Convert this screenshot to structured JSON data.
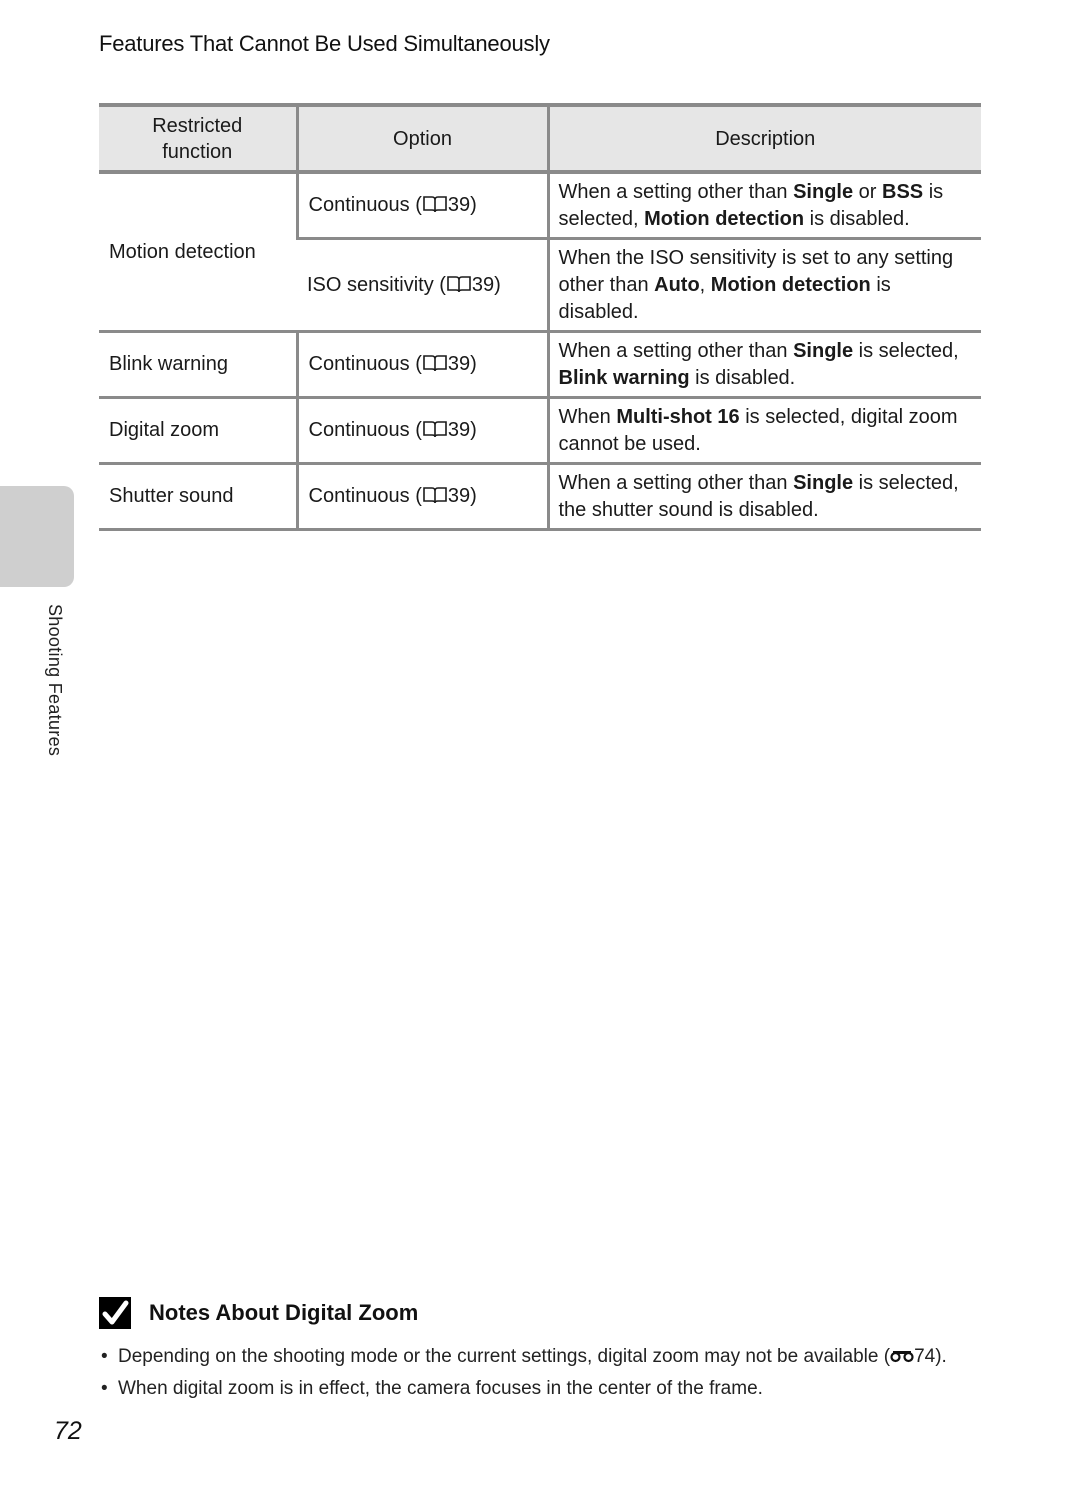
{
  "section_title": "Features That Cannot Be Used Simultaneously",
  "table": {
    "headers": [
      "Restricted function",
      "Option",
      "Description"
    ],
    "header_first_lines": [
      "Restricted",
      "function"
    ],
    "rows": [
      {
        "function": "Motion detection",
        "options": [
          {
            "option": "Continuous (",
            "ref": "39)",
            "description": [
              {
                "t": "When a setting other than ",
                "b": false
              },
              {
                "t": "Single",
                "b": true
              },
              {
                "t": " or ",
                "b": false
              },
              {
                "t": "BSS",
                "b": true
              },
              {
                "t": " is selected, ",
                "b": false
              },
              {
                "t": "Motion detection",
                "b": true
              },
              {
                "t": " is disabled.",
                "b": false
              }
            ]
          },
          {
            "option": "ISO sensitivity (",
            "ref": "39)",
            "description": [
              {
                "t": "When the ISO sensitivity is set to any setting other than ",
                "b": false
              },
              {
                "t": "Auto",
                "b": true
              },
              {
                "t": ", ",
                "b": false
              },
              {
                "t": "Motion detection",
                "b": true
              },
              {
                "t": " is disabled.",
                "b": false
              }
            ]
          }
        ]
      },
      {
        "function": "Blink warning",
        "options": [
          {
            "option": "Continuous (",
            "ref": "39)",
            "description": [
              {
                "t": "When a setting other than ",
                "b": false
              },
              {
                "t": "Single",
                "b": true
              },
              {
                "t": " is selected, ",
                "b": false
              },
              {
                "t": "Blink warning",
                "b": true
              },
              {
                "t": " is disabled.",
                "b": false
              }
            ]
          }
        ]
      },
      {
        "function": "Digital zoom",
        "options": [
          {
            "option": "Continuous (",
            "ref": "39)",
            "description": [
              {
                "t": "When ",
                "b": false
              },
              {
                "t": "Multi-shot 16",
                "b": true
              },
              {
                "t": " is selected, digital zoom cannot be used.",
                "b": false
              }
            ]
          }
        ]
      },
      {
        "function": "Shutter sound",
        "options": [
          {
            "option": "Continuous (",
            "ref": "39)",
            "description": [
              {
                "t": "When a setting other than ",
                "b": false
              },
              {
                "t": "Single",
                "b": true
              },
              {
                "t": " is selected, the shutter sound is disabled.",
                "b": false
              }
            ]
          }
        ]
      }
    ]
  },
  "side_tab": {
    "label": "Shooting Features",
    "color": "#cfcfcf"
  },
  "notes": {
    "icon": "checkbox-check-icon",
    "title": "Notes About Digital Zoom",
    "items": [
      {
        "before": "Depending on the shooting mode or the current settings, digital zoom may not be available (",
        "icon": "binoculars-reference-icon",
        "after": "74)."
      },
      {
        "before": "When digital zoom is in effect, the camera focuses in the center of the frame.",
        "icon": null,
        "after": ""
      }
    ]
  },
  "page_number": "72",
  "colors": {
    "rule": "#8a8a8a",
    "header_bg": "#e6e6e6",
    "tab_bg": "#cfcfcf"
  }
}
